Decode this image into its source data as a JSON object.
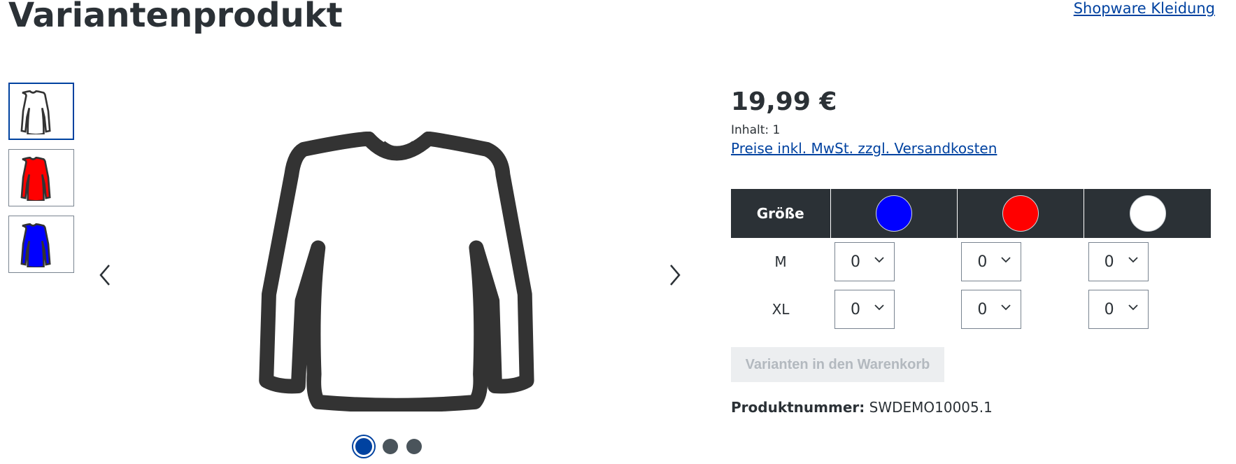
{
  "page": {
    "title": "Variantenprodukt",
    "manufacturer_link": "Shopware Kleidung"
  },
  "gallery": {
    "thumbnails": [
      {
        "icon": "shirt-icon",
        "color": "#ffffff",
        "active": true
      },
      {
        "icon": "shirt-icon",
        "color": "#ff0000",
        "active": false
      },
      {
        "icon": "shirt-icon",
        "color": "#0000ff",
        "active": false
      }
    ],
    "main_image": {
      "icon": "shirt-icon",
      "color": "#ffffff"
    },
    "prev_icon": "chevron-left-icon",
    "next_icon": "chevron-right-icon",
    "dots": [
      true,
      false,
      false
    ]
  },
  "buybox": {
    "price": "19,99 €",
    "content": "Inhalt: 1",
    "tax_link": "Preise inkl. MwSt. zzgl. Versandkosten",
    "matrix": {
      "size_header": "Größe",
      "colors": [
        "#0000ff",
        "#ff0000",
        "#ffffff"
      ],
      "rows": [
        {
          "size": "M",
          "quantities": [
            "0",
            "0",
            "0"
          ]
        },
        {
          "size": "XL",
          "quantities": [
            "0",
            "0",
            "0"
          ]
        }
      ]
    },
    "cart_button": "Varianten in den Warenkorb",
    "product_number_label": "Produktnummer:",
    "product_number_value": "SWDEMO10005.1"
  },
  "colors": {
    "accent": "#0042a0",
    "dark": "#2b3136"
  }
}
